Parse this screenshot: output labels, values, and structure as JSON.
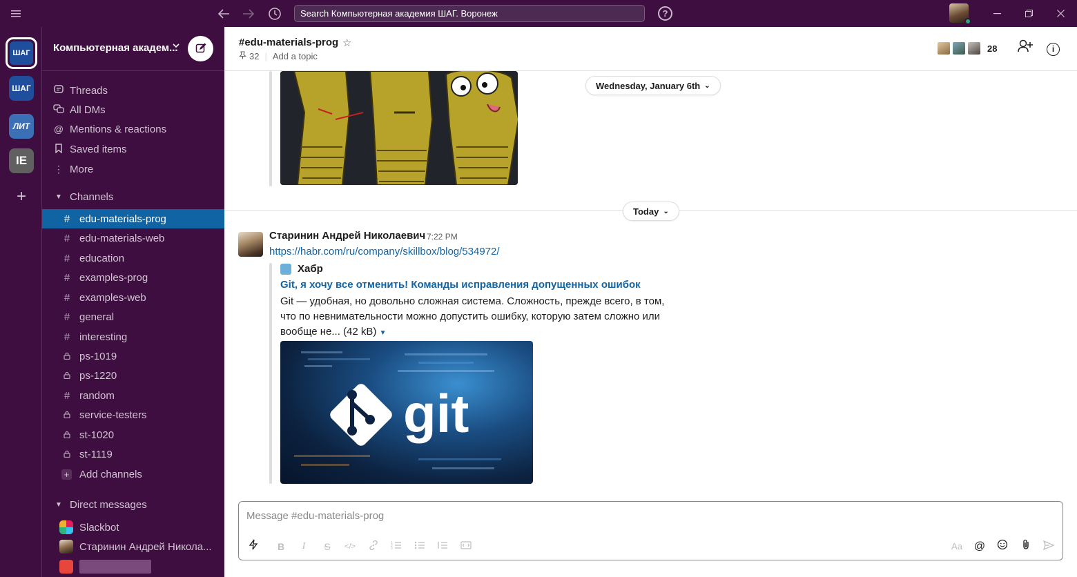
{
  "topbar": {
    "menu_icon": "hamburger-icon",
    "back_icon": "arrow-left-icon",
    "forward_icon": "arrow-right-icon",
    "history_icon": "clock-icon",
    "search_placeholder": "Search Компьютерная академия ШАГ. Воронеж",
    "help_icon": "help-icon",
    "help_glyph": "?",
    "status_color": "#2bac76"
  },
  "rail": {
    "workspaces": [
      {
        "label": "ШАГ",
        "active": true,
        "color": "#1f4e9c"
      },
      {
        "label": "ШАГ",
        "active": false,
        "color": "#1f4e9c"
      },
      {
        "label": "ЛИТ",
        "active": false,
        "color": "#3b6fb6"
      },
      {
        "label": "IE",
        "active": false,
        "color": "#616061"
      }
    ],
    "add_glyph": "+"
  },
  "sidebar": {
    "workspace_name": "Компьютерная академ...",
    "nav": [
      {
        "label": "Threads",
        "icon": "threads-icon"
      },
      {
        "label": "All DMs",
        "icon": "dms-icon"
      },
      {
        "label": "Mentions & reactions",
        "icon": "at-icon"
      },
      {
        "label": "Saved items",
        "icon": "bookmark-icon"
      },
      {
        "label": "More",
        "icon": "more-vertical-icon"
      }
    ],
    "channels_header": "Channels",
    "channels": [
      {
        "name": "edu-materials-prog",
        "private": false,
        "active": true
      },
      {
        "name": "edu-materials-web",
        "private": false
      },
      {
        "name": "education",
        "private": false
      },
      {
        "name": "examples-prog",
        "private": false
      },
      {
        "name": "examples-web",
        "private": false
      },
      {
        "name": "general",
        "private": false
      },
      {
        "name": "interesting",
        "private": false
      },
      {
        "name": "ps-1019",
        "private": true
      },
      {
        "name": "ps-1220",
        "private": true
      },
      {
        "name": "random",
        "private": false
      },
      {
        "name": "service-testers",
        "private": true
      },
      {
        "name": "st-1020",
        "private": true
      },
      {
        "name": "st-1119",
        "private": true
      }
    ],
    "add_channels": "Add channels",
    "dm_header": "Direct messages",
    "dms": [
      {
        "name": "Slackbot"
      },
      {
        "name": "Старинин Андрей Никола..."
      }
    ]
  },
  "channel": {
    "title": "#edu-materials-prog",
    "pinned_count": "32",
    "topic_placeholder": "Add a topic",
    "member_count": "28"
  },
  "messages": {
    "date_prev": "Wednesday, January 6th",
    "date_today": "Today",
    "author": "Старинин Андрей Николаевич",
    "time": "7:22 PM",
    "link": "https://habr.com/ru/company/skillbox/blog/534972/",
    "unfurl": {
      "site": "Хабр",
      "title": "Git, я хочу все отменить! Команды исправления допущенных ошибок",
      "description": "Git — удобная, но довольно сложная система. Сложность, прежде всего, в том, что по невнимательности можно допустить ошибку, которую затем сложно или вообще не...",
      "size": "(42 kB)",
      "image_text": "git"
    }
  },
  "composer": {
    "placeholder": "Message #edu-materials-prog"
  }
}
